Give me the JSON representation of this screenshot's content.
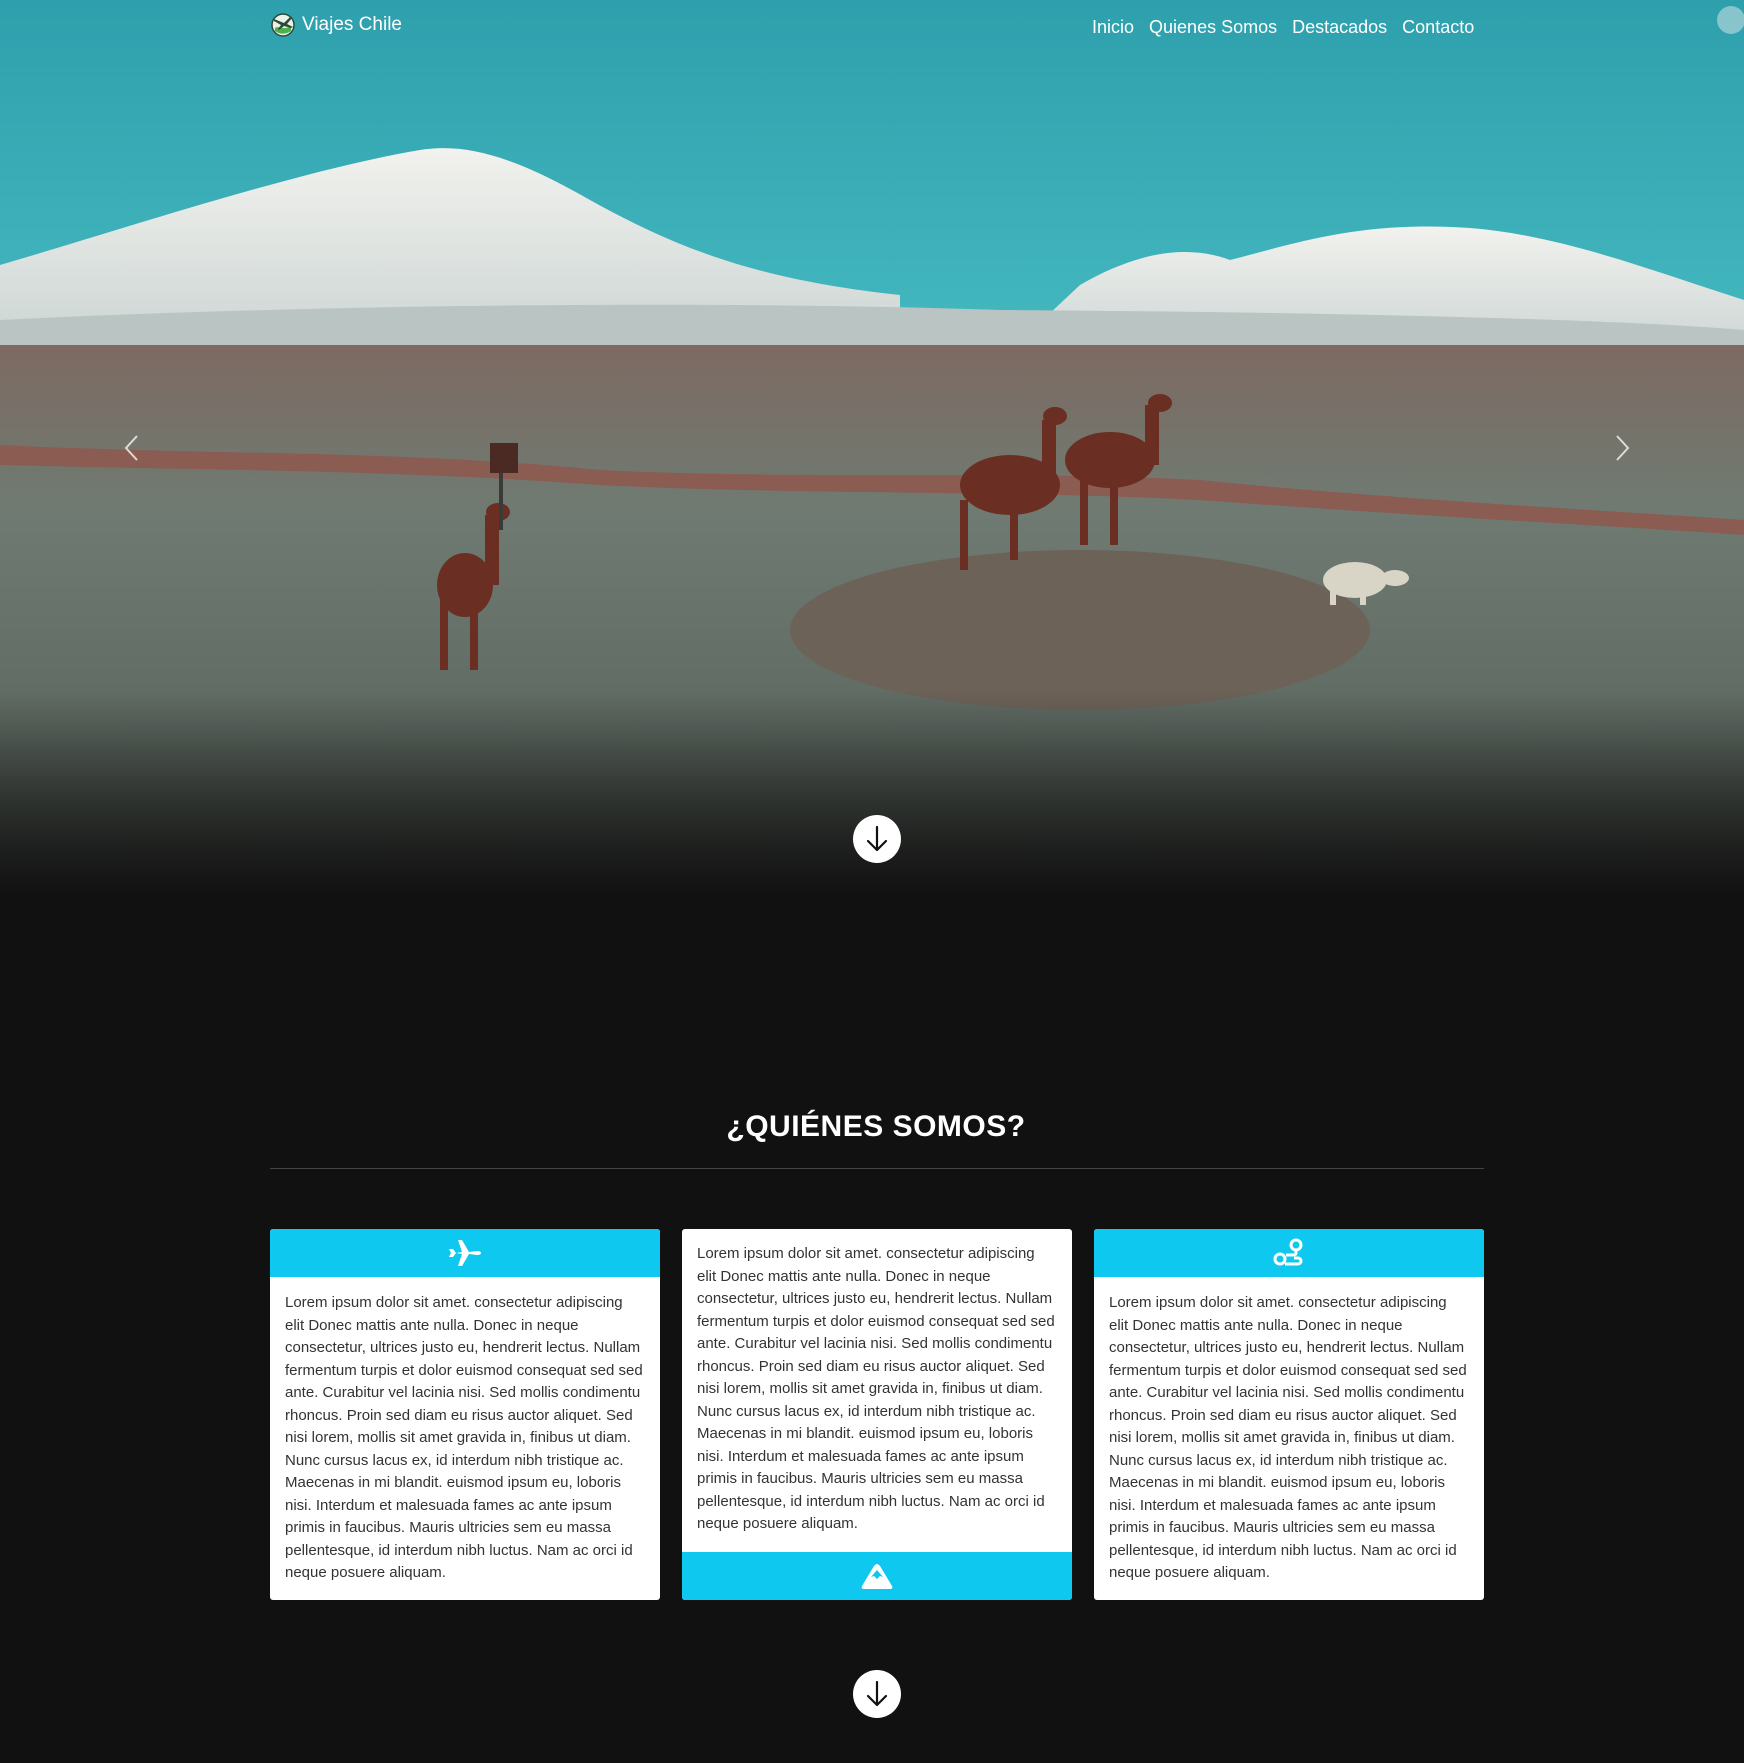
{
  "navbar": {
    "brand": "Viajes Chile",
    "links": [
      "Inicio",
      "Quienes Somos",
      "Destacados",
      "Contacto"
    ]
  },
  "hero": {
    "image": "altiplano-llamas-volcano"
  },
  "about": {
    "title": "¿QUIÉNES SOMOS?",
    "cards": [
      {
        "icon": "plane-icon",
        "text": "Lorem ipsum dolor sit amet. consectetur adipiscing elit Donec mattis ante nulla. Donec in neque consectetur, ultrices justo eu, hendrerit lectus. Nullam fermentum turpis et dolor euismod consequat sed sed ante. Curabitur vel lacinia nisi. Sed mollis condimentu rhoncus. Proin sed diam eu risus auctor aliquet. Sed nisi lorem, mollis sit amet gravida in, finibus ut diam. Nunc cursus lacus ex, id interdum nibh tristique ac. Maecenas in mi blandit. euismod ipsum eu, loboris nisi. Interdum et malesuada fames ac ante ipsum primis in faucibus. Mauris ultricies sem eu massa pellentesque, id interdum nibh luctus. Nam ac orci id neque posuere aliquam."
      },
      {
        "icon": "mountain-icon",
        "text": "Lorem ipsum dolor sit amet. consectetur adipiscing elit Donec mattis ante nulla. Donec in neque consectetur, ultrices justo eu, hendrerit lectus. Nullam fermentum turpis et dolor euismod consequat sed sed ante. Curabitur vel lacinia nisi. Sed mollis condimentu rhoncus. Proin sed diam eu risus auctor aliquet. Sed nisi lorem, mollis sit amet gravida in, finibus ut diam. Nunc cursus lacus ex, id interdum nibh tristique ac. Maecenas in mi blandit. euismod ipsum eu, loboris nisi. Interdum et malesuada fames ac ante ipsum primis in faucibus. Mauris ultricies sem eu massa pellentesque, id interdum nibh luctus. Nam ac orci id neque posuere aliquam."
      },
      {
        "icon": "route-icon",
        "text": "Lorem ipsum dolor sit amet. consectetur adipiscing elit Donec mattis ante nulla. Donec in neque consectetur, ultrices justo eu, hendrerit lectus. Nullam fermentum turpis et dolor euismod consequat sed sed ante. Curabitur vel lacinia nisi. Sed mollis condimentu rhoncus. Proin sed diam eu risus auctor aliquet. Sed nisi lorem, mollis sit amet gravida in, finibus ut diam. Nunc cursus lacus ex, id interdum nibh tristique ac. Maecenas in mi blandit. euismod ipsum eu, loboris nisi. Interdum et malesuada fames ac ante ipsum primis in faucibus. Mauris ultricies sem eu massa pellentesque, id interdum nibh luctus. Nam ac orci id neque posuere aliquam."
      }
    ]
  },
  "colors": {
    "accent": "#0ec8ef",
    "background": "#111111",
    "card": "#ffffff",
    "sky": "#3aa8b2"
  }
}
